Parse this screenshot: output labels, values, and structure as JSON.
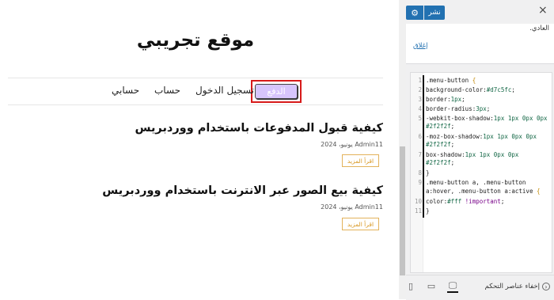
{
  "preview": {
    "site_title": "موقع تجريبي",
    "menu": {
      "items": [
        "تسجيل الدخول",
        "حساب",
        "حسابي"
      ],
      "button_label": "الدفع"
    },
    "posts": [
      {
        "title": "كيفية قبول المدفوعات باستخدام ووردبريس",
        "meta": "Admin11 يونيو، 2024",
        "read_more": "اقرأ المزيد"
      },
      {
        "title": "كيفية بيع الصور عبر الانترنت باستخدام ووردبريس",
        "meta": "Admin11 يونيو، 2024",
        "read_more": "اقرأ المزيد"
      }
    ]
  },
  "sidebar": {
    "close_icon": "×",
    "publish_label": "نشر",
    "settings_icon": "gear-icon",
    "notice_text": "العادي.",
    "close_link": "إغلاق",
    "code_lines": [
      {
        "n": "1",
        "t": ".menu-button {"
      },
      {
        "n": "2",
        "t": "background-color:#d7c5fc;"
      },
      {
        "n": "3",
        "t": "border:1px;"
      },
      {
        "n": "4",
        "t": "border-radius:3px;"
      },
      {
        "n": "5",
        "t": "-webkit-box-shadow:1px 1px 0px 0px",
        "cont": "#2f2f2f;"
      },
      {
        "n": "6",
        "t": "-moz-box-shadow:1px 1px 0px 0px",
        "cont": "#2f2f2f;"
      },
      {
        "n": "7",
        "t": "box-shadow:1px 1px 0px 0px",
        "cont": "#2f2f2f;"
      },
      {
        "n": "8",
        "t": "}"
      },
      {
        "n": "9",
        "t": ".menu-button a, .menu-button",
        "cont": "a:hover, .menu-button a:active {"
      },
      {
        "n": "10",
        "t": "color:#fff !important;"
      },
      {
        "n": "11",
        "t": "}"
      }
    ],
    "hide_controls_label": "إخفاء عناصر التحكم",
    "devices": [
      "desktop-icon",
      "tablet-icon",
      "mobile-icon"
    ]
  },
  "colors": {
    "menu_button_bg": "#d7c5fc",
    "highlight_border": "#d71a1a",
    "accent": "#2271b1",
    "read_more": "#d8961e"
  }
}
